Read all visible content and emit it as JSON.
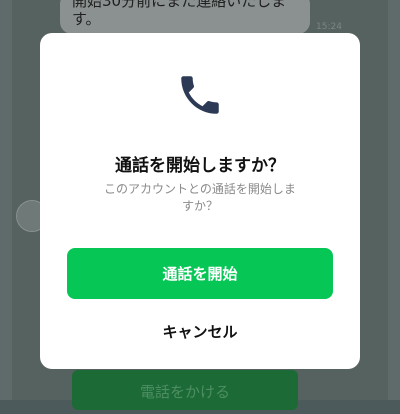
{
  "background": {
    "message_line1": "開始30分前にまた連絡いたしま",
    "message_line2": "す。",
    "time": "15:24",
    "call_button_label": "電話をかける"
  },
  "dialog": {
    "icon": "phone-icon",
    "title": "通話を開始しますか？",
    "description": "このアカウントとの通話を開始しますか？",
    "start_label": "通話を開始",
    "cancel_label": "キャンセル"
  },
  "colors": {
    "primary_green": "#06c755",
    "icon_navy": "#2c3a55"
  }
}
